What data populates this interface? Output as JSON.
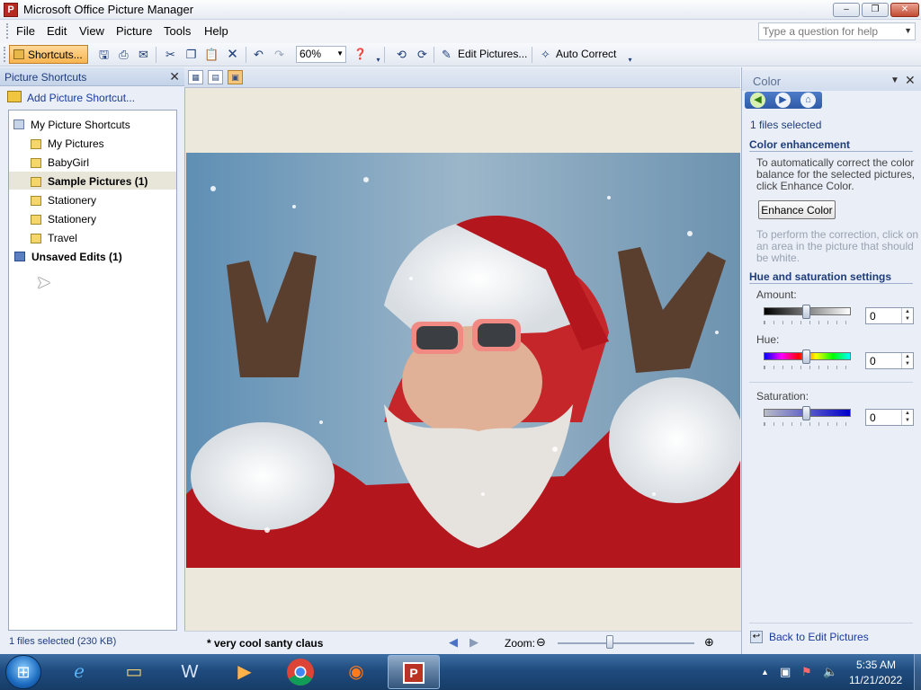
{
  "window": {
    "title": "Microsoft Office Picture Manager",
    "app_icon": "picture-manager-icon"
  },
  "controls": {
    "minimize": "–",
    "maximize": "❐",
    "close": "✕"
  },
  "menu": [
    "File",
    "Edit",
    "View",
    "Picture",
    "Tools",
    "Help"
  ],
  "help_box": {
    "placeholder": "Type a question for help"
  },
  "toolbar": {
    "shortcuts_label": "Shortcuts...",
    "zoom_value": "60%",
    "edit_pictures_label": "Edit Pictures...",
    "auto_correct_label": "Auto Correct"
  },
  "left_pane": {
    "title": "Picture Shortcuts",
    "add_link": "Add Picture Shortcut...",
    "tree": [
      {
        "label": "My Picture Shortcuts",
        "level": 0,
        "bold": false
      },
      {
        "label": "My Pictures",
        "level": 1,
        "bold": false
      },
      {
        "label": "BabyGirl",
        "level": 1,
        "bold": false
      },
      {
        "label": "Sample Pictures (1)",
        "level": 1,
        "bold": true
      },
      {
        "label": "Stationery",
        "level": 1,
        "bold": false
      },
      {
        "label": "Stationery",
        "level": 1,
        "bold": false
      },
      {
        "label": "Travel",
        "level": 1,
        "bold": false
      },
      {
        "label": "Unsaved Edits (1)",
        "level": 0,
        "bold": true
      }
    ],
    "status": "1 files selected (230 KB)"
  },
  "center": {
    "caption": "* very cool santy claus",
    "zoom_label": "Zoom:",
    "zoom_level": 0.38
  },
  "right_pane": {
    "title": "Color",
    "files_selected": "1 files selected",
    "color_enhancement_heading": "Color enhancement",
    "auto_text_1": "To automatically correct the color",
    "auto_text_2": "balance for the selected pictures,",
    "auto_text_3": "click Enhance Color.",
    "enhance_button": "Enhance Color",
    "perform_text_1": "To perform the correction, click on",
    "perform_text_2": "an area in the picture that should",
    "perform_text_3": "be white.",
    "hue_heading": "Hue and saturation settings",
    "amount_label": "Amount:",
    "amount_value": "0",
    "hue_label": "Hue:",
    "hue_value": "0",
    "saturation_label": "Saturation:",
    "saturation_value": "0",
    "back_link": "Back to Edit Pictures"
  },
  "taskbar": {
    "items": [
      "ie-icon",
      "explorer-icon",
      "word-icon",
      "media-player-icon",
      "chrome-icon",
      "firefox-icon",
      "picture-manager-icon"
    ],
    "time": "5:35 AM",
    "date": "11/21/2022"
  },
  "colors": {
    "accent": "#f7b54f",
    "link": "#1a3a9a",
    "heading": "#1e3d7b",
    "taskbar": "#1f4b7e"
  }
}
